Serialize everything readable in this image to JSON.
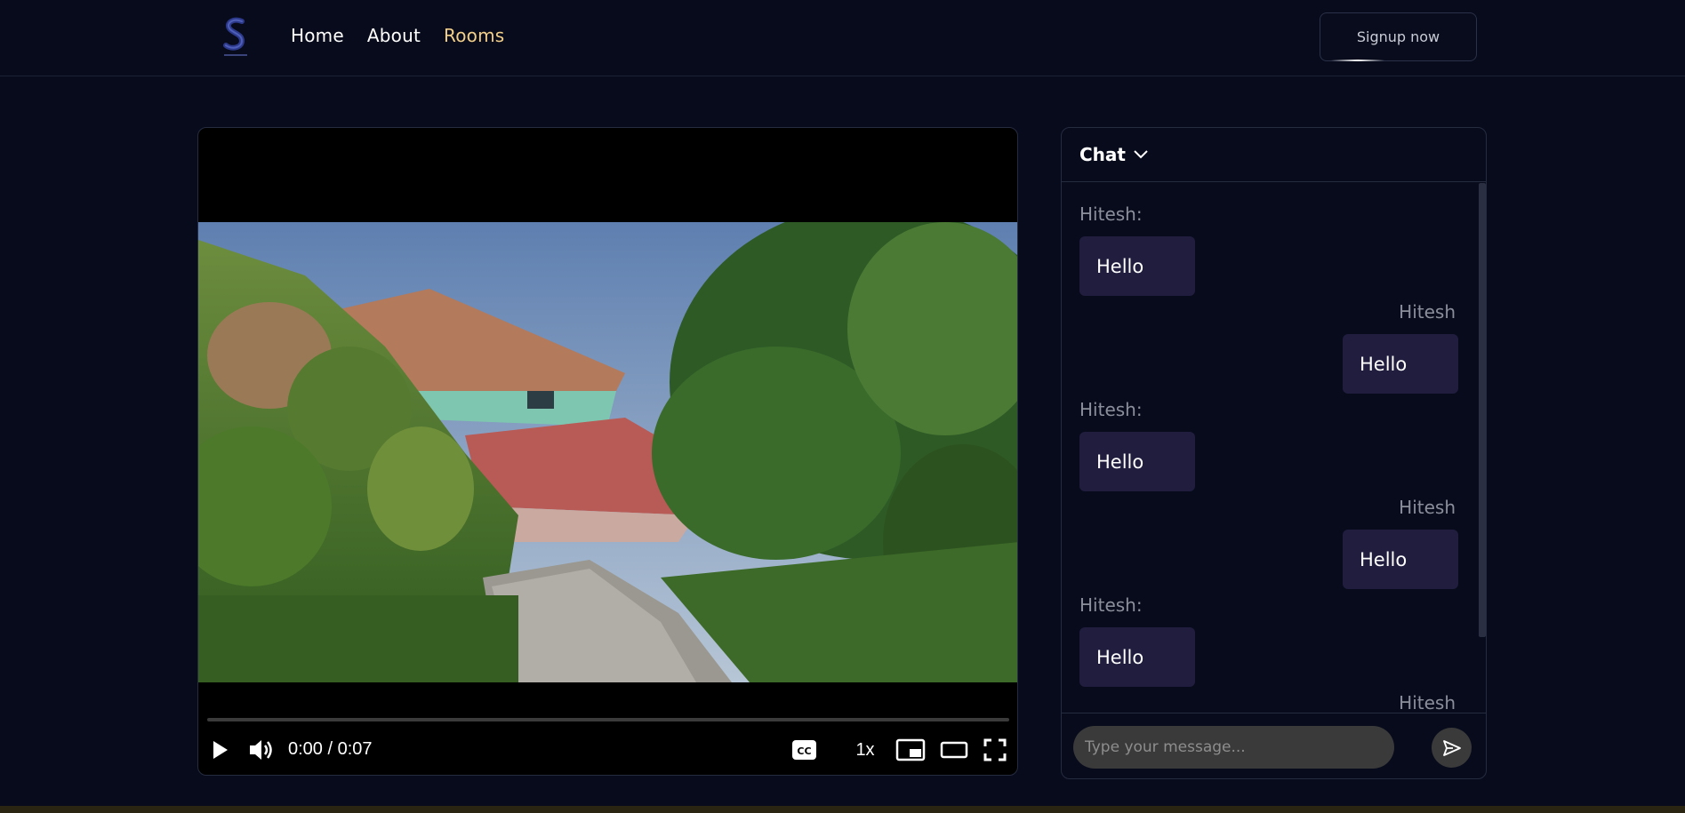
{
  "nav": {
    "links": [
      {
        "label": "Home"
      },
      {
        "label": "About"
      },
      {
        "label": "Rooms"
      }
    ],
    "active": "Rooms",
    "signup_label": "Signup now",
    "colors": {
      "active_link": "#f2cf8a",
      "background": "#070b1b"
    }
  },
  "player": {
    "current_time": "0:00",
    "duration": "0:07",
    "time_display": "0:00 / 0:07",
    "progress": 0,
    "speed": "1x",
    "icons": [
      "play-icon",
      "volume-icon",
      "captions-icon",
      "miniplayer-icon",
      "theater-icon",
      "fullscreen-icon"
    ]
  },
  "chat": {
    "title": "Chat",
    "messages": [
      {
        "sender": "Hitesh:",
        "text": "Hello",
        "side": "left"
      },
      {
        "sender": "Hitesh",
        "text": "Hello",
        "side": "right"
      },
      {
        "sender": "Hitesh:",
        "text": "Hello",
        "side": "left"
      },
      {
        "sender": "Hitesh",
        "text": "Hello",
        "side": "right"
      },
      {
        "sender": "Hitesh:",
        "text": "Hello",
        "side": "left"
      },
      {
        "sender": "Hitesh",
        "text": "",
        "side": "right"
      }
    ],
    "input_placeholder": "Type your message...",
    "bubble_color": "#201d3e"
  }
}
